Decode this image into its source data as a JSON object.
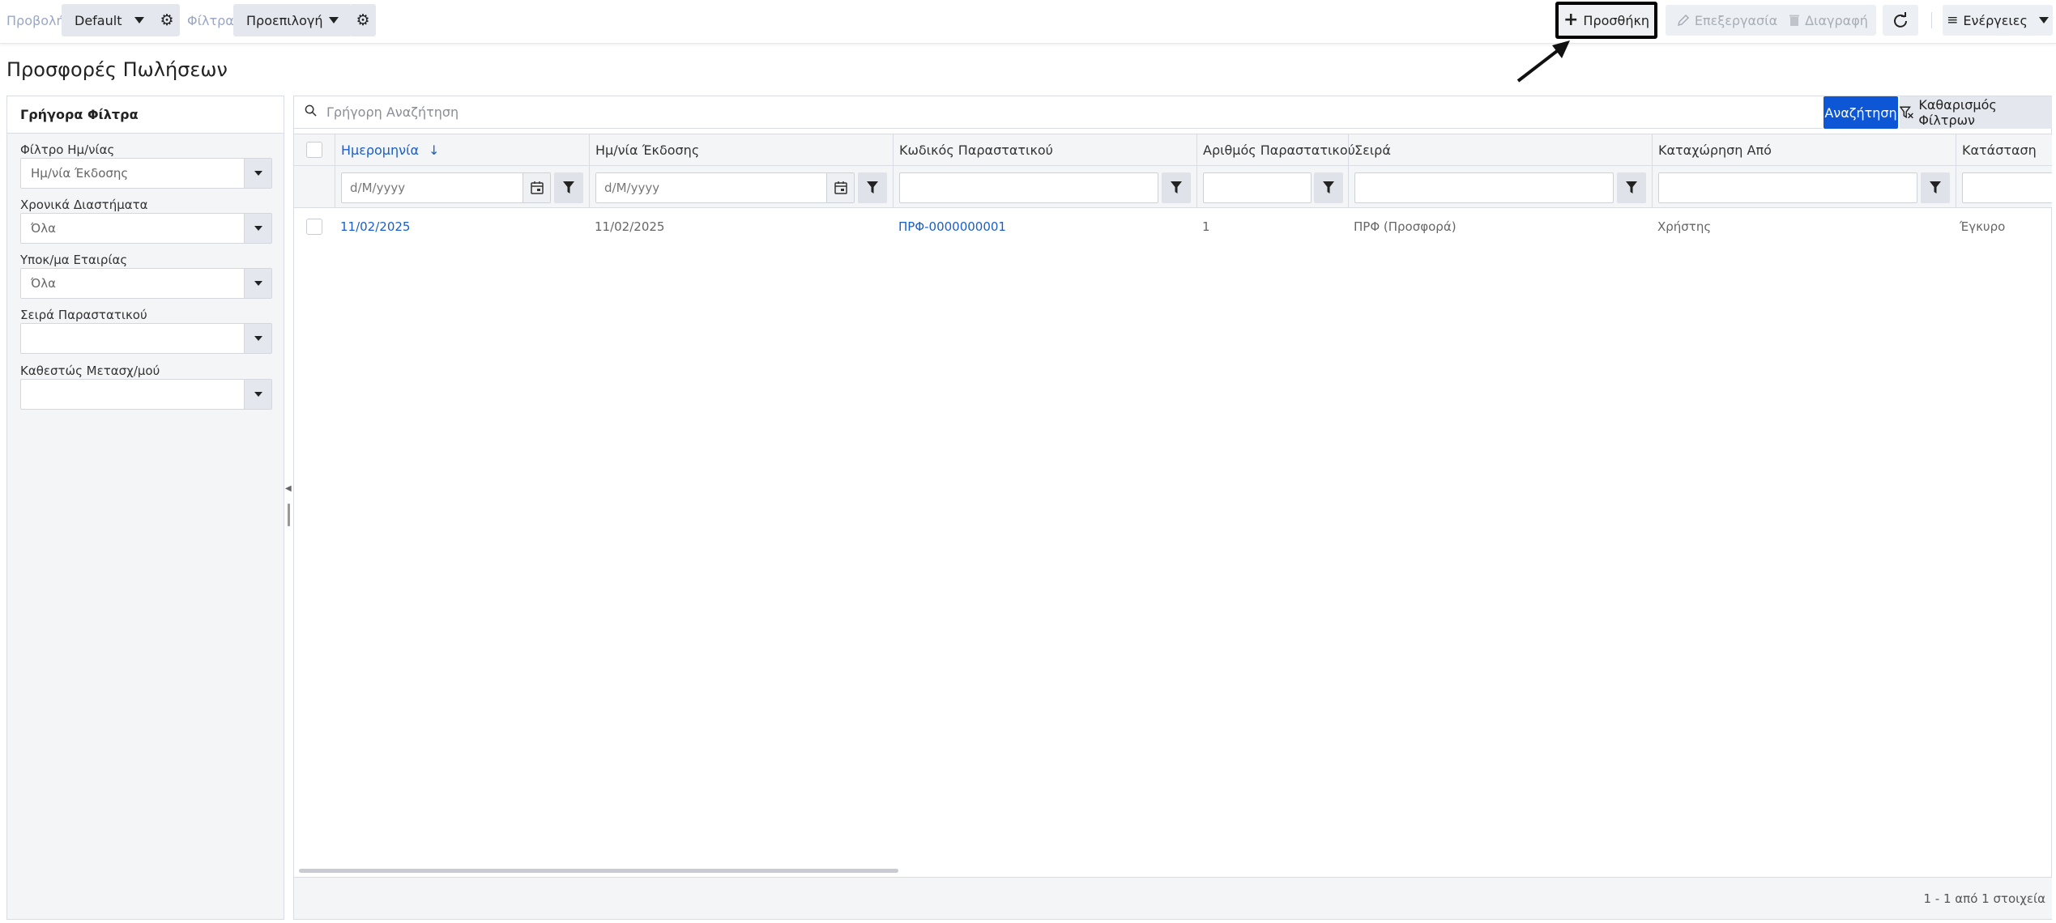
{
  "toolbar": {
    "view_label": "Προβολή",
    "view_value": "Default",
    "filters_label": "Φίλτρα",
    "filters_value": "Προεπιλογή",
    "add_label": "Προσθήκη",
    "edit_label": "Επεξεργασία",
    "delete_label": "Διαγραφή",
    "actions_label": "Ενέργειες"
  },
  "page": {
    "title": "Προσφορές Πωλήσεων"
  },
  "quick_filters": {
    "title": "Γρήγορα Φίλτρα",
    "fields": [
      {
        "label": "Φίλτρο Ημ/νίας",
        "value": "Ημ/νία Έκδοσης"
      },
      {
        "label": "Χρονικά Διαστήματα",
        "value": "Όλα"
      },
      {
        "label": "Υποκ/μα Εταιρίας",
        "value": "Όλα"
      },
      {
        "label": "Σειρά Παραστατικού",
        "value": ""
      },
      {
        "label": "Καθεστώς Μετασχ/μού",
        "value": ""
      }
    ]
  },
  "search": {
    "placeholder": "Γρήγορη Αναζήτηση",
    "search_button": "Αναζήτηση",
    "clear_button": "Καθαρισμός Φίλτρων"
  },
  "grid": {
    "columns": [
      {
        "label": "Ημερομηνία",
        "sorted": "desc"
      },
      {
        "label": "Ημ/νία Έκδοσης"
      },
      {
        "label": "Κωδικός Παραστατικού"
      },
      {
        "label": "Αριθμός Παραστατικού"
      },
      {
        "label": "Σειρά"
      },
      {
        "label": "Καταχώρηση Από"
      },
      {
        "label": "Κατάσταση"
      }
    ],
    "date_placeholder": "d/M/yyyy",
    "rows": [
      {
        "date": "11/02/2025",
        "issue_date": "11/02/2025",
        "doc_code": "ΠΡΦ-0000000001",
        "doc_number": "1",
        "series": "ΠΡΦ (Προσφορά)",
        "entered_by": "Χρήστης",
        "status": "Έγκυρο"
      }
    ],
    "pager_text": "1 - 1 από 1 στοιχεία"
  },
  "colors": {
    "primary": "#0d57d6",
    "link": "#1a5fc8",
    "toolbar_muted": "#9aa7c4"
  }
}
